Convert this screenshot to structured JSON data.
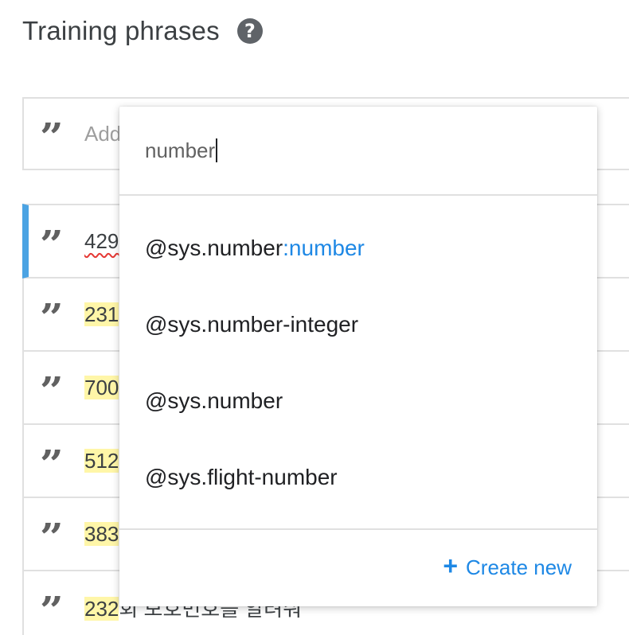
{
  "section": {
    "title": "Training phrases",
    "help_icon": "question-circle-icon"
  },
  "add_phrase": {
    "placeholder": "Add",
    "icon": "quote-icon"
  },
  "phrases": [
    {
      "highlight": "",
      "plain": "429",
      "selected": true,
      "misspelled": true
    },
    {
      "highlight": "231",
      "plain": "",
      "selected": false
    },
    {
      "highlight": "700",
      "plain": "",
      "selected": false
    },
    {
      "highlight": "512",
      "plain": "",
      "selected": false
    },
    {
      "highlight": "383",
      "plain": "",
      "selected": false
    },
    {
      "highlight": "232",
      "plain": "회 보호번호를 알려줘",
      "selected": false
    }
  ],
  "dropdown": {
    "search_value": "number",
    "options": [
      {
        "entity": "@sys.number",
        "suffix": ":number"
      },
      {
        "entity": "@sys.number-integer",
        "suffix": ""
      },
      {
        "entity": "@sys.number",
        "suffix": ""
      },
      {
        "entity": "@sys.flight-number",
        "suffix": ""
      }
    ],
    "create_new_label": "Create new",
    "create_new_icon": "plus-icon"
  },
  "colors": {
    "accent": "#1e88e5",
    "selected_bar": "#4ba3e3",
    "highlight": "#fff6a8"
  }
}
